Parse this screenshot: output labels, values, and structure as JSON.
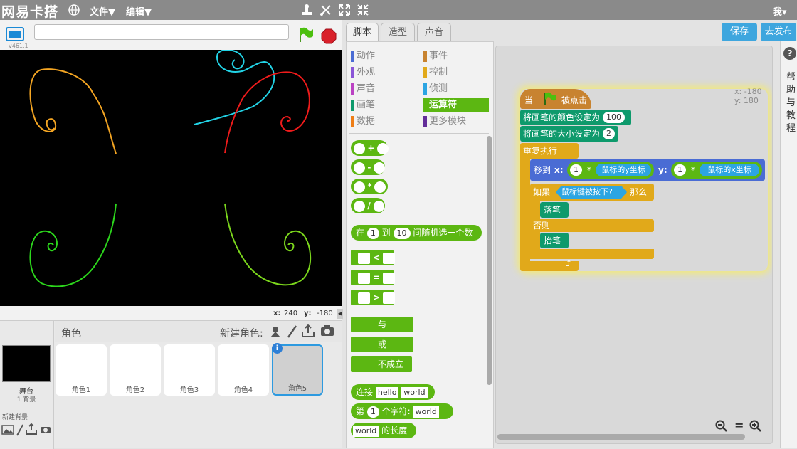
{
  "app": {
    "logo": "网易卡搭",
    "menu_file": "文件▼",
    "menu_edit": "编辑▼",
    "user": "我▾"
  },
  "stage": {
    "version": "v461.1",
    "project_title": "",
    "x_label": "x:",
    "x_value": "240",
    "y_label": "y:",
    "y_value": "-180"
  },
  "sprites": {
    "header": "角色",
    "new_sprite": "新建角色:",
    "stage_label": "舞台",
    "stage_backdrops": "1 背景",
    "new_backdrop": "新建背景",
    "items": [
      "角色1",
      "角色2",
      "角色3",
      "角色4",
      "角色5"
    ],
    "info_badge": "i"
  },
  "tabs": [
    "脚本",
    "造型",
    "声音"
  ],
  "buttons": {
    "save": "保存",
    "publish": "去发布",
    "help": "?"
  },
  "help_text": [
    "帮",
    "助",
    "与",
    "教",
    "程"
  ],
  "categories": [
    {
      "label": "动作",
      "color": "#4a6cd4"
    },
    {
      "label": "事件",
      "color": "#c88330"
    },
    {
      "label": "外观",
      "color": "#8a55d7"
    },
    {
      "label": "控制",
      "color": "#e1a91a"
    },
    {
      "label": "声音",
      "color": "#bb42c3"
    },
    {
      "label": "侦测",
      "color": "#2ca5e2"
    },
    {
      "label": "画笔",
      "color": "#0e9a6c"
    },
    {
      "label": "运算符",
      "color": "#5cb712"
    },
    {
      "label": "数据",
      "color": "#ee7d16"
    },
    {
      "label": "更多模块",
      "color": "#632d99"
    }
  ],
  "operators": {
    "add": "+",
    "sub": "-",
    "mul": "*",
    "div": "/",
    "rand_prefix": "在",
    "rand_a": "1",
    "rand_to": "到",
    "rand_b": "10",
    "rand_suffix": "间随机选一个数",
    "lt": "<",
    "eq": "=",
    "gt": ">",
    "and": "与",
    "or": "或",
    "not": "不成立",
    "join": "连接",
    "join_a": "hello",
    "join_b": "world",
    "letter_prefix": "第",
    "letter_n": "1",
    "letter_mid": "个字符:",
    "letter_word": "world",
    "length_word": "world",
    "length_suffix": "的长度"
  },
  "script": {
    "hat_when": "当",
    "hat_clicked": "被点击",
    "set_color": "将画笔的颜色设定为",
    "color_val": "100",
    "set_size": "将画笔的大小设定为",
    "size_val": "2",
    "forever": "重复执行",
    "goto": "移到",
    "goto_x": "x:",
    "goto_y": "y:",
    "one": "1",
    "times": "*",
    "mouse_y": "鼠标的y坐标",
    "mouse_x": "鼠标的x坐标",
    "if": "如果",
    "mouse_down": "鼠标键被按下?",
    "then": "那么",
    "pen_down": "落笔",
    "else": "否则",
    "pen_up": "抬笔",
    "sprite_x": "x: -180",
    "sprite_y": "y: 180"
  },
  "colors": {
    "topbar": "#8a8a8a",
    "events": "#c88330",
    "pen": "#0e9a6c",
    "control": "#e1a91a",
    "motion": "#4a6cd4",
    "sensing": "#2ca5e2",
    "operators": "#5cb712"
  }
}
